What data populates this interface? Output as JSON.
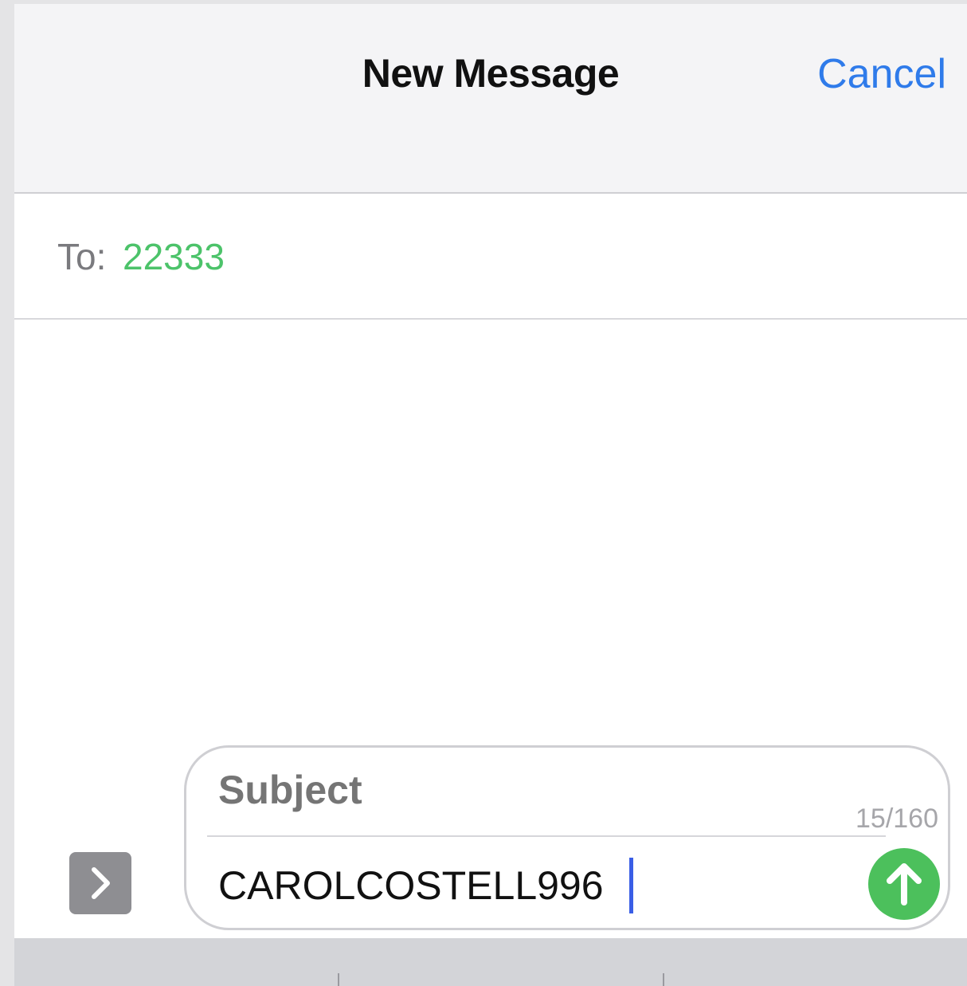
{
  "header": {
    "title": "New Message",
    "cancel_label": "Cancel"
  },
  "recipient": {
    "to_label": "To:",
    "value": "22333"
  },
  "compose": {
    "subject_placeholder": "Subject",
    "char_count": "15/160",
    "message_text": "CAROLCOSTELL996"
  },
  "icons": {
    "expand": "chevron-right-icon",
    "send": "arrow-up-icon"
  },
  "colors": {
    "accent_blue": "#2f7bea",
    "recipient_green": "#4cc36a",
    "send_green": "#4cc05c",
    "caret_blue": "#3a5ee6"
  }
}
